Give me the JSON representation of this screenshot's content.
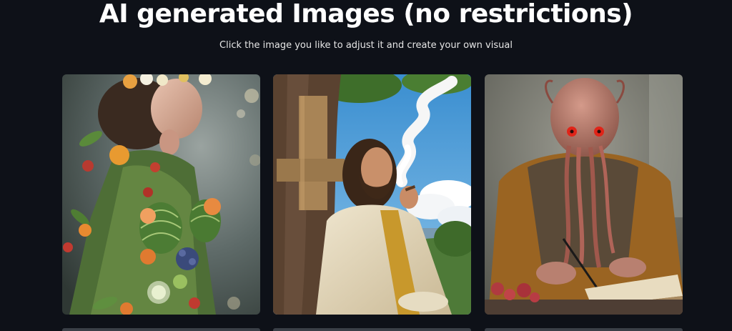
{
  "header": {
    "title": "AI generated Images (no restrictions)",
    "subtitle": "Click the image you like to adjust it and create your own visual"
  },
  "gallery": {
    "items": [
      {
        "icon": "image-fruit-woman"
      },
      {
        "icon": "image-bearded-man-smoking"
      },
      {
        "icon": "image-tentacle-creature-writing"
      }
    ]
  }
}
